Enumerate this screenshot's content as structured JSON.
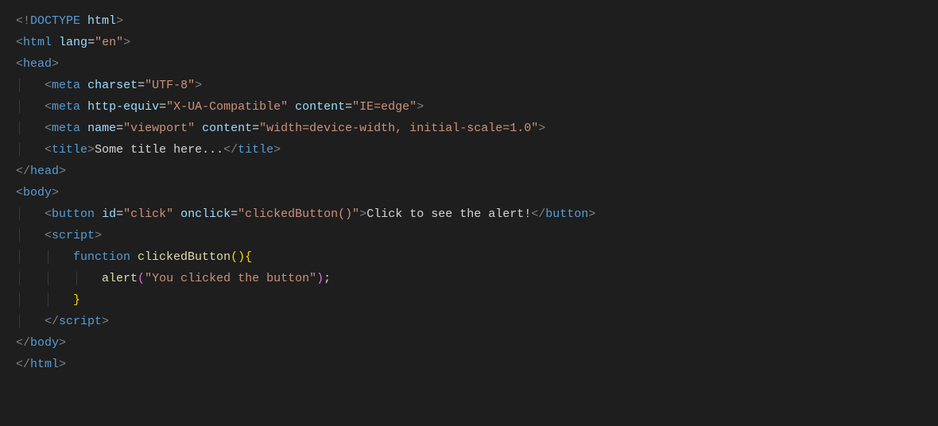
{
  "code": {
    "doctype": "DOCTYPE",
    "doctype_html": "html",
    "html_tag": "html",
    "lang_attr": "lang",
    "lang_val": "\"en\"",
    "head_tag": "head",
    "meta_tag": "meta",
    "charset_attr": "charset",
    "charset_val": "\"UTF-8\"",
    "httpequiv_attr": "http-equiv",
    "httpequiv_val": "\"X-UA-Compatible\"",
    "content_attr": "content",
    "ieedge_val": "\"IE=edge\"",
    "name_attr": "name",
    "viewport_val": "\"viewport\"",
    "vpcontent_val": "\"width=device-width, initial-scale=1.0\"",
    "title_tag": "title",
    "title_text": "Some title here...",
    "body_tag": "body",
    "button_tag": "button",
    "id_attr": "id",
    "id_val": "\"click\"",
    "onclick_attr": "onclick",
    "onclick_val": "\"clickedButton()\"",
    "button_text": "Click to see the alert!",
    "script_tag": "script",
    "function_kw": "function",
    "function_name": "clickedButton",
    "alert_call": "alert",
    "alert_arg": "\"You clicked the button\""
  }
}
